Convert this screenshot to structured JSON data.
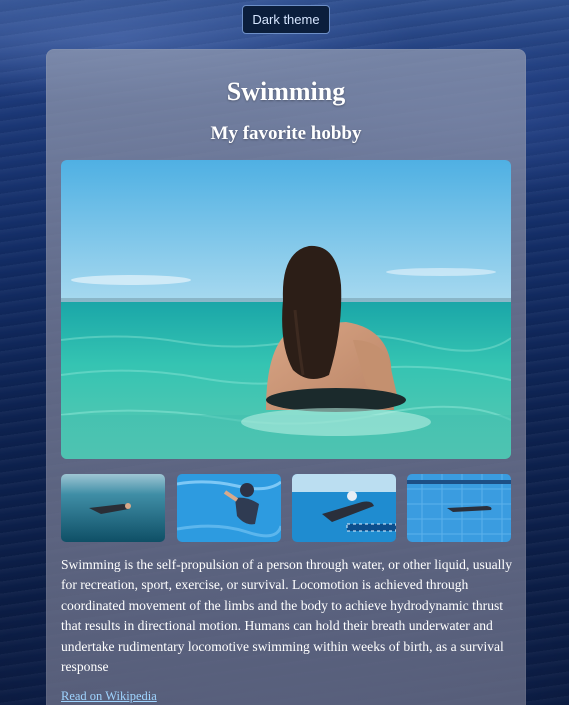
{
  "header": {
    "theme_toggle_label": "Dark theme"
  },
  "card": {
    "title": "Swimming",
    "subtitle": "My favorite hobby",
    "hero_image": "woman-swimming-in-turquoise-sea-photo",
    "thumbnails": [
      "underwater-pool-swimmer-photo",
      "freestyle-swimmer-pool-photo",
      "breaststroke-swimmer-lane-rope-photo",
      "swimmer-gliding-pool-tiles-photo"
    ],
    "description": "Swimming is the self-propulsion of a person through water, or other liquid, usually for recreation, sport, exercise, or survival. Locomotion is achieved through coordinated movement of the limbs and the body to achieve hydrodynamic thrust that results in directional motion. Humans can hold their breath underwater and undertake rudimentary locomotive swimming within weeks of birth, as a survival response",
    "link_text": "Read on Wikipedia"
  },
  "colors": {
    "background": "#132d66",
    "card": "#8a90aa",
    "link": "#9fd4ff",
    "button_bg": "#0b1e3c"
  }
}
